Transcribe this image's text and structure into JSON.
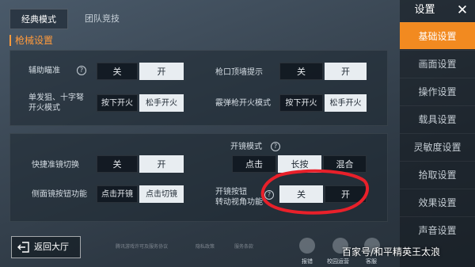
{
  "tabs": [
    {
      "label": "经典模式"
    },
    {
      "label": "团队竞技"
    }
  ],
  "section_title": "枪械设置",
  "panel1": {
    "aim_assist": {
      "label": "辅助瞄准",
      "off": "关",
      "on": "开",
      "selected": "开"
    },
    "muzzle_hint": {
      "label": "枪口顶墙提示",
      "off": "关",
      "on": "开",
      "selected": "开"
    },
    "single_shot": {
      "label_line1": "单发狙、十字弩",
      "label_line2": "开火模式",
      "opt1": "按下开火",
      "opt2": "松手开火",
      "selected": "松手开火"
    },
    "shotgun": {
      "label": "霰弹枪开火模式",
      "opt1": "按下开火",
      "opt2": "松手开火",
      "selected": "松手开火"
    }
  },
  "panel2": {
    "scope_mode": {
      "label": "开镜模式",
      "opt1": "点击",
      "opt2": "长按",
      "opt3": "混合",
      "selected": "长按"
    },
    "quick_scope": {
      "label": "快捷准镜切换",
      "off": "关",
      "on": "开",
      "selected": "开"
    },
    "side_scope": {
      "label": "侧面镜按钮功能",
      "opt1": "点击开镜",
      "opt2": "点击切镜",
      "selected": "点击切镜"
    },
    "scope_turn": {
      "label_line1": "开镜按钮",
      "label_line2": "转动视角功能",
      "off": "关",
      "on": "开",
      "selected": "关"
    }
  },
  "sidebar": {
    "title": "设置",
    "close": "✕",
    "items": [
      {
        "label": "基础设置"
      },
      {
        "label": "画面设置"
      },
      {
        "label": "操作设置"
      },
      {
        "label": "载具设置"
      },
      {
        "label": "灵敏度设置"
      },
      {
        "label": "拾取设置"
      },
      {
        "label": "效果设置"
      },
      {
        "label": "声音设置"
      }
    ],
    "active_index": 0
  },
  "bottom": {
    "back_label": "返回大厅",
    "footnotes": [
      "腾讯游戏许可及服务协议",
      "隐私政策",
      "服务条款"
    ],
    "icons": [
      {
        "label": "报错",
        "icon": "warning-icon"
      },
      {
        "label": "校园运营",
        "icon": "shield-icon"
      },
      {
        "label": "客服",
        "icon": "service-icon"
      }
    ]
  },
  "watermark": "百家号/和平精英王太浪",
  "colors": {
    "accent": "#f28a20",
    "annotation": "#e8202a"
  }
}
